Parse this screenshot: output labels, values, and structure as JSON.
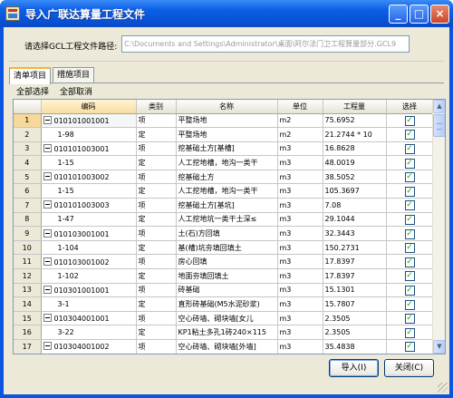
{
  "window": {
    "title": "导入广联达算量工程文件",
    "controls": {
      "minimize": "_",
      "maximize": "□",
      "close": "×"
    }
  },
  "path": {
    "label": "请选择GCL工程文件路径:",
    "value": "C:\\Documents and Settings\\Administrator\\桌面\\阿尔法门卫工程算量部分.GCL9"
  },
  "tabs": [
    {
      "label": "清单项目",
      "active": true
    },
    {
      "label": "措施项目",
      "active": false
    }
  ],
  "actions": {
    "select_all": "全部选择",
    "deselect_all": "全部取消"
  },
  "table": {
    "columns": [
      "",
      "编码",
      "类别",
      "名称",
      "单位",
      "工程量",
      "选择"
    ],
    "rows": [
      {
        "num": "1",
        "code": "010101001001",
        "type": "项",
        "name": "平整场地",
        "unit": "m2",
        "qty": "75.6952",
        "checked": true,
        "parent": true
      },
      {
        "num": "2",
        "code": "1-98",
        "type": "定",
        "name": "平整场地",
        "unit": "m2",
        "qty": "21.2744 * 10",
        "checked": true,
        "parent": false
      },
      {
        "num": "3",
        "code": "010101003001",
        "type": "项",
        "name": "挖基础土方[基槽]",
        "unit": "m3",
        "qty": "16.8628",
        "checked": true,
        "parent": true
      },
      {
        "num": "4",
        "code": "1-15",
        "type": "定",
        "name": "人工挖地槽，地沟一类干",
        "unit": "m3",
        "qty": "48.0019",
        "checked": true,
        "parent": false
      },
      {
        "num": "5",
        "code": "010101003002",
        "type": "项",
        "name": "挖基础土方",
        "unit": "m3",
        "qty": "38.5052",
        "checked": true,
        "parent": true
      },
      {
        "num": "6",
        "code": "1-15",
        "type": "定",
        "name": "人工挖地槽，地沟一类干",
        "unit": "m3",
        "qty": "105.3697",
        "checked": true,
        "parent": false
      },
      {
        "num": "7",
        "code": "010101003003",
        "type": "项",
        "name": "挖基础土方[基坑]",
        "unit": "m3",
        "qty": "7.08",
        "checked": true,
        "parent": true
      },
      {
        "num": "8",
        "code": "1-47",
        "type": "定",
        "name": "人工挖地坑一类干土深≤",
        "unit": "m3",
        "qty": "29.1044",
        "checked": true,
        "parent": false
      },
      {
        "num": "9",
        "code": "010103001001",
        "type": "项",
        "name": "土(石)方回填",
        "unit": "m3",
        "qty": "32.3443",
        "checked": true,
        "parent": true
      },
      {
        "num": "10",
        "code": "1-104",
        "type": "定",
        "name": "基(槽)坑夯填回填土",
        "unit": "m3",
        "qty": "150.2731",
        "checked": true,
        "parent": false
      },
      {
        "num": "11",
        "code": "010103001002",
        "type": "项",
        "name": "房心回填",
        "unit": "m3",
        "qty": "17.8397",
        "checked": true,
        "parent": true
      },
      {
        "num": "12",
        "code": "1-102",
        "type": "定",
        "name": "地面夯填回填土",
        "unit": "m3",
        "qty": "17.8397",
        "checked": true,
        "parent": false
      },
      {
        "num": "13",
        "code": "010301001001",
        "type": "项",
        "name": "砖基础",
        "unit": "m3",
        "qty": "15.1301",
        "checked": true,
        "parent": true
      },
      {
        "num": "14",
        "code": "3-1",
        "type": "定",
        "name": "直形砖基础(M5水泥砂浆)",
        "unit": "m3",
        "qty": "15.7807",
        "checked": true,
        "parent": false
      },
      {
        "num": "15",
        "code": "010304001001",
        "type": "项",
        "name": "空心砖墙、砌块墙[女儿",
        "unit": "m3",
        "qty": "2.3505",
        "checked": true,
        "parent": true
      },
      {
        "num": "16",
        "code": "3-22",
        "type": "定",
        "name": "KP1粘土多孔1砖240×115",
        "unit": "m3",
        "qty": "2.3505",
        "checked": true,
        "parent": false
      },
      {
        "num": "17",
        "code": "010304001002",
        "type": "项",
        "name": "空心砖墙、砌块墙[外墙]",
        "unit": "m3",
        "qty": "35.4838",
        "checked": true,
        "parent": true
      }
    ]
  },
  "buttons": {
    "import": "导入(I)",
    "close": "关闭(C)"
  },
  "colors": {
    "titlebar": "#0754d8",
    "client_bg": "#ece9d8",
    "checkmark": "#21a121",
    "selected_row_header": "#f6d99a"
  }
}
